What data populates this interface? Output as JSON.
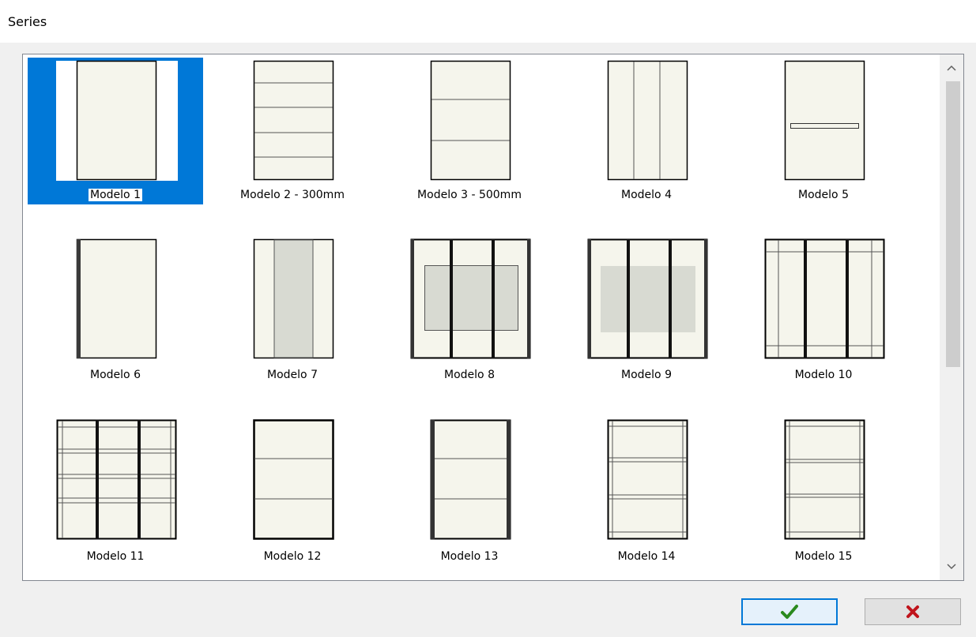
{
  "window": {
    "title": "Series"
  },
  "list": {
    "items": [
      {
        "label": "Modelo 1",
        "selected": true
      },
      {
        "label": "Modelo 2 - 300mm"
      },
      {
        "label": "Modelo 3 - 500mm"
      },
      {
        "label": "Modelo 4"
      },
      {
        "label": "Modelo 5"
      },
      {
        "label": "Modelo 6"
      },
      {
        "label": "Modelo 7"
      },
      {
        "label": "Modelo 8"
      },
      {
        "label": "Modelo 9"
      },
      {
        "label": "Modelo 10"
      },
      {
        "label": "Modelo 11"
      },
      {
        "label": "Modelo 12"
      },
      {
        "label": "Modelo 13"
      },
      {
        "label": "Modelo 14"
      },
      {
        "label": "Modelo 15"
      }
    ]
  },
  "buttons": {
    "ok_icon": "checkmark-icon",
    "cancel_icon": "x-icon"
  },
  "colors": {
    "selection": "#0078d7",
    "panel_fill": "#f5f5ec",
    "grey_fill": "#d8dad2",
    "ok_green": "#2b8a1e",
    "cancel_red": "#c0141c"
  }
}
